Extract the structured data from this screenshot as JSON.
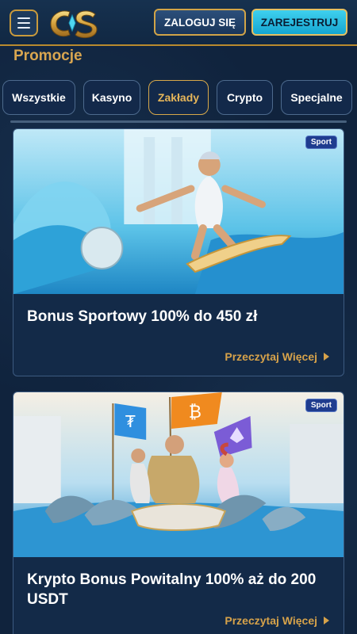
{
  "header": {
    "login_label": "ZALOGUJ SIĘ",
    "register_label": "ZAREJESTRUJ"
  },
  "page": {
    "title": "Promocje"
  },
  "tabs": [
    {
      "label": "Wszystkie",
      "active": false
    },
    {
      "label": "Kasyno",
      "active": false
    },
    {
      "label": "Zakłady",
      "active": true
    },
    {
      "label": "Crypto",
      "active": false
    },
    {
      "label": "Specjalne",
      "active": false
    }
  ],
  "promotions": [
    {
      "badge": "Sport",
      "title": "Bonus Sportowy 100% do 450 zł",
      "read_more": "Przeczytaj Więcej"
    },
    {
      "badge": "Sport",
      "title": "Krypto Bonus Powitalny 100% aż do 200 USDT",
      "read_more": "Przeczytaj Więcej"
    }
  ],
  "colors": {
    "accent_gold": "#d6a24a",
    "background": "#10233d",
    "register_cyan": "#2bbde2",
    "badge_blue": "#1f3c8f"
  },
  "icons": [
    "hamburger-menu-icon",
    "cs-logo",
    "chevron-right-icon"
  ]
}
